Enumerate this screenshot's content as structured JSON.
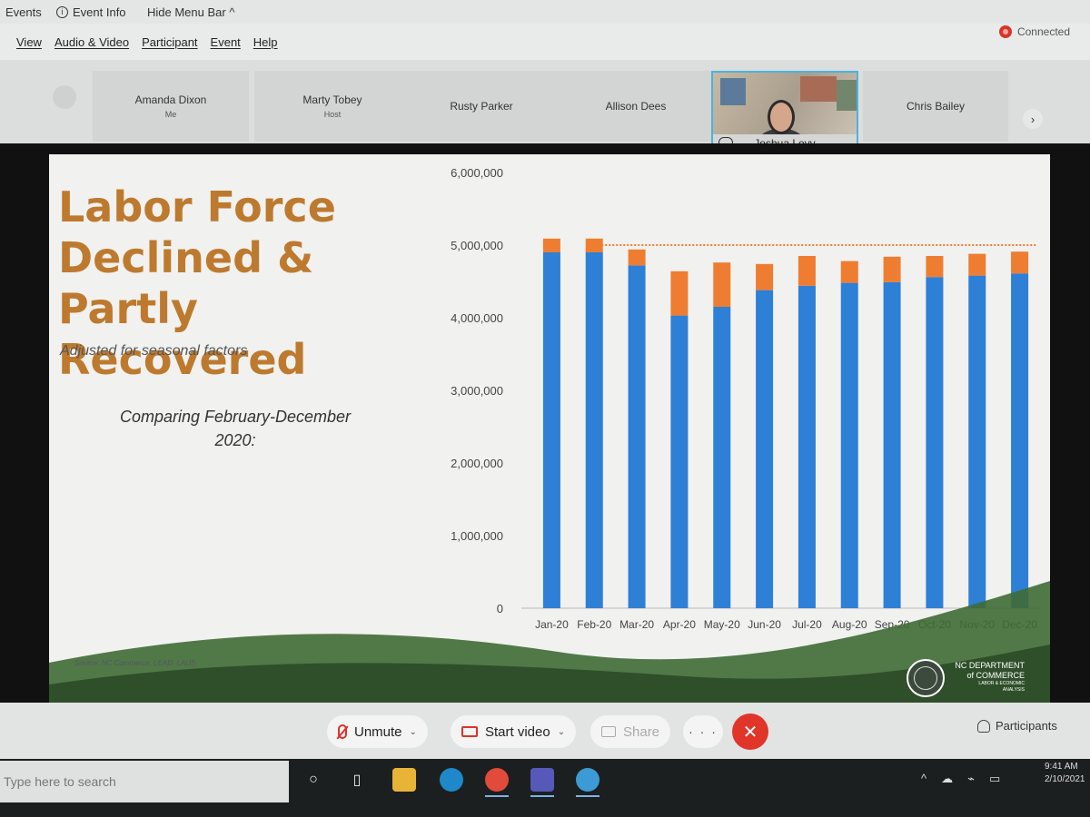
{
  "topbar": {
    "events_label": "Events",
    "event_info_label": "Event Info",
    "hide_menu_label": "Hide Menu Bar ^"
  },
  "menu": {
    "items": [
      "View",
      "Audio & Video",
      "Participant",
      "Event",
      "Help"
    ],
    "status": "Connected"
  },
  "participants": {
    "tiles": [
      {
        "name": "Amanda Dixon",
        "role": "Me"
      },
      {
        "name": "Marty Tobey",
        "role": "Host"
      },
      {
        "name": "Rusty Parker",
        "role": ""
      },
      {
        "name": "Allison Dees",
        "role": ""
      },
      {
        "name": "Joshua Levy",
        "role": ""
      },
      {
        "name": "Chris Bailey",
        "role": ""
      }
    ],
    "next_glyph": "›"
  },
  "slide": {
    "title_lines": [
      "Labor Force",
      "Declined & Partly",
      "Recovered"
    ],
    "subtitle": "Adjusted for seasonal factors",
    "compare_line1": "Comparing February-December",
    "compare_line2": "2020:",
    "source": "Source: NC Commerce, LEAD, LAUS",
    "org_line1": "NC DEPARTMENT",
    "org_line2": "of COMMERCE",
    "org_line3": "LABOR & ECONOMIC",
    "org_line4": "ANALYSIS",
    "colors": {
      "title": "#bd7a2f",
      "series_employed": "#2e7fd6",
      "series_unemployed": "#ee7d31",
      "wave": "#3f6b34"
    }
  },
  "chart_data": {
    "type": "bar",
    "stacked": true,
    "categories": [
      "Jan-20",
      "Feb-20",
      "Mar-20",
      "Apr-20",
      "May-20",
      "Jun-20",
      "Jul-20",
      "Aug-20",
      "Sep-20",
      "Oct-20",
      "Nov-20",
      "Dec-20"
    ],
    "series": [
      {
        "values": [
          4900000,
          4900000,
          4720000,
          4030000,
          4150000,
          4380000,
          4440000,
          4480000,
          4490000,
          4560000,
          4580000,
          4610000
        ],
        "color": "#2e7fd6"
      },
      {
        "values": [
          190000,
          190000,
          220000,
          610000,
          610000,
          360000,
          410000,
          300000,
          350000,
          290000,
          300000,
          300000
        ],
        "color": "#ee7d31"
      }
    ],
    "reference_line": {
      "value": 5000000,
      "style": "dotted",
      "color": "#ee7d31"
    },
    "ylim": [
      0,
      6000000
    ],
    "y_ticks": [
      "0",
      "1,000,000",
      "2,000,000",
      "3,000,000",
      "4,000,000",
      "5,000,000",
      "6,000,000"
    ],
    "grid": false,
    "legend": "none"
  },
  "controls": {
    "unmute_label": "Unmute",
    "start_video_label": "Start video",
    "share_label": "Share",
    "more_label": "· · ·",
    "end_label": "✕",
    "participants_label": "Participants"
  },
  "taskbar": {
    "search_placeholder": "Type here to search",
    "time": "9:41 AM",
    "date": "2/10/2021"
  }
}
